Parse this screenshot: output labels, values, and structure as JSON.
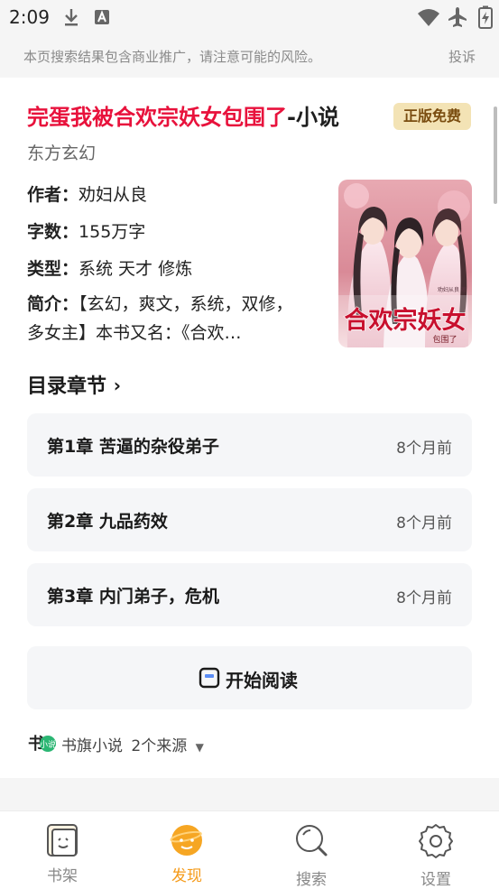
{
  "status_bar": {
    "time": "2:09"
  },
  "notice": {
    "text": "本页搜索结果包含商业推广，请注意可能的风险。",
    "report": "投诉"
  },
  "book": {
    "title_main": "完蛋我被合欢宗妖女包围了",
    "title_suffix": "-小说",
    "badge": "正版免费",
    "category": "东方玄幻",
    "author_label": "作者：",
    "author": "劝妇从良",
    "words_label": "字数：",
    "words": "155万字",
    "type_label": "类型：",
    "type": "系统 天才 修炼",
    "intro_label": "简介：",
    "intro": "【玄幻，爽文，系统，双修，多女主】本书又名：《合欢…",
    "cover_title": "合欢宗妖女",
    "cover_subtitle": "包围了",
    "cover_author": "劝妇从良 著"
  },
  "toc": {
    "heading": "目录章节",
    "chapters": [
      {
        "title": "第1章 苦逼的杂役弟子",
        "time": "8个月前"
      },
      {
        "title": "第2章 九品药效",
        "time": "8个月前"
      },
      {
        "title": "第3章 内门弟子，危机",
        "time": "8个月前"
      }
    ]
  },
  "read_button": {
    "label": "开始阅读"
  },
  "source": {
    "name": "书旗小说",
    "count": "2个来源"
  },
  "tabs": [
    {
      "label": "书架",
      "icon": "bookshelf-icon"
    },
    {
      "label": "发现",
      "icon": "discover-icon"
    },
    {
      "label": "搜索",
      "icon": "search-icon"
    },
    {
      "label": "设置",
      "icon": "settings-icon"
    }
  ],
  "colors": {
    "accent": "#f59a18",
    "title_red": "#e8123c",
    "badge_bg": "#f3e3b5"
  }
}
